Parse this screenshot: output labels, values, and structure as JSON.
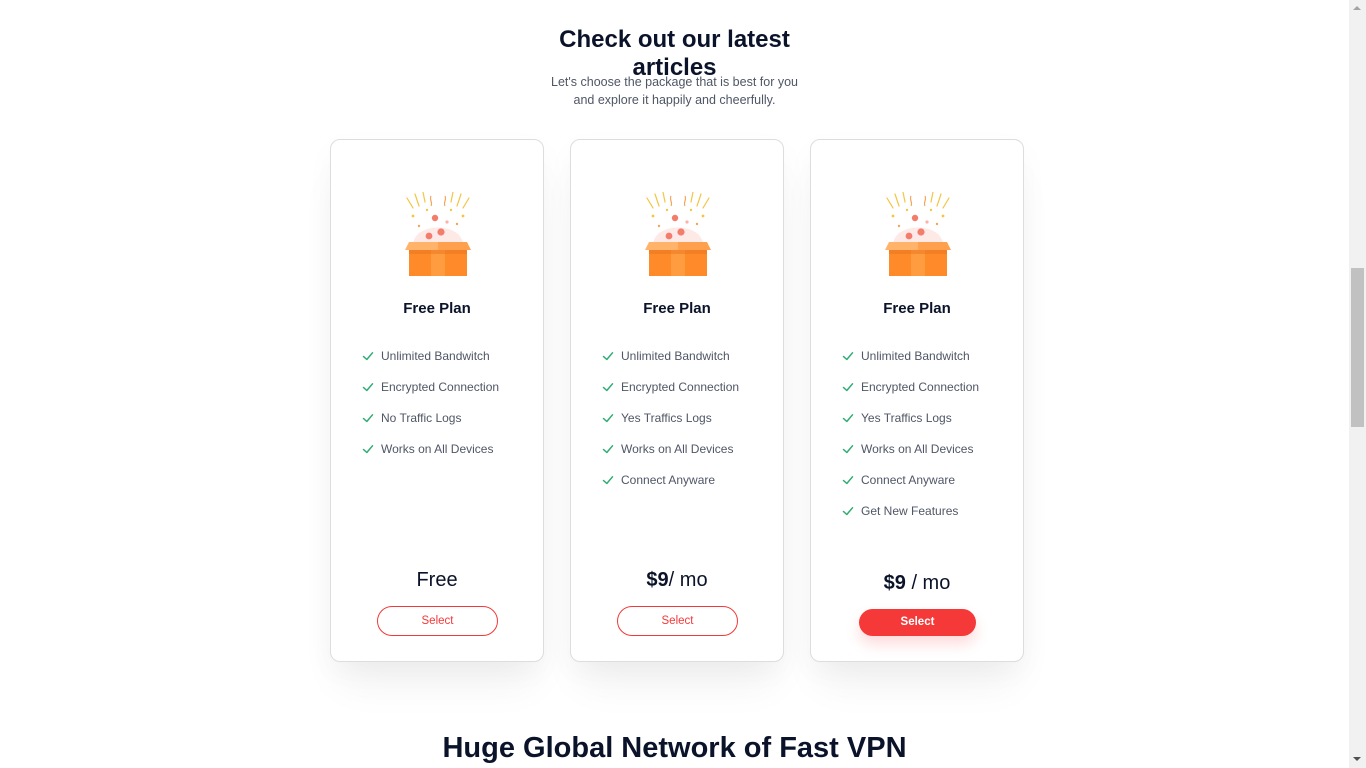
{
  "section": {
    "title_line1": "Check out our latest",
    "title_line2": "articles",
    "subtitle_line1": "Let's choose the package that is best for you",
    "subtitle_line2": "and explore it happily and cheerfully."
  },
  "plans": [
    {
      "title": "Free Plan",
      "features": [
        "Unlimited Bandwitch",
        "Encrypted Connection",
        "No Traffic Logs",
        "Works on All Devices"
      ],
      "price_main": "Free",
      "price_suffix": "",
      "button_label": "Select",
      "button_style": "outline"
    },
    {
      "title": "Free Plan",
      "features": [
        "Unlimited Bandwitch",
        "Encrypted Connection",
        "Yes Traffics Logs",
        "Works on All Devices",
        "Connect Anyware"
      ],
      "price_main": "$9",
      "price_suffix": "/ mo",
      "button_label": "Select",
      "button_style": "outline"
    },
    {
      "title": "Free Plan",
      "features": [
        "Unlimited Bandwitch",
        "Encrypted Connection",
        "Yes Traffics Logs",
        "Works on All Devices",
        "Connect Anyware",
        "Get New Features"
      ],
      "price_main": "$9",
      "price_suffix": " / mo",
      "button_label": "Select",
      "button_style": "filled"
    }
  ],
  "next_section": {
    "title": "Huge Global Network of Fast VPN"
  },
  "icons": {
    "plan_art": "gift-box-icon",
    "feature_bullet": "check-icon"
  },
  "colors": {
    "accent": "#f53838",
    "check": "#2fab73",
    "heading": "#0b132a",
    "body_text": "#4f5665"
  }
}
